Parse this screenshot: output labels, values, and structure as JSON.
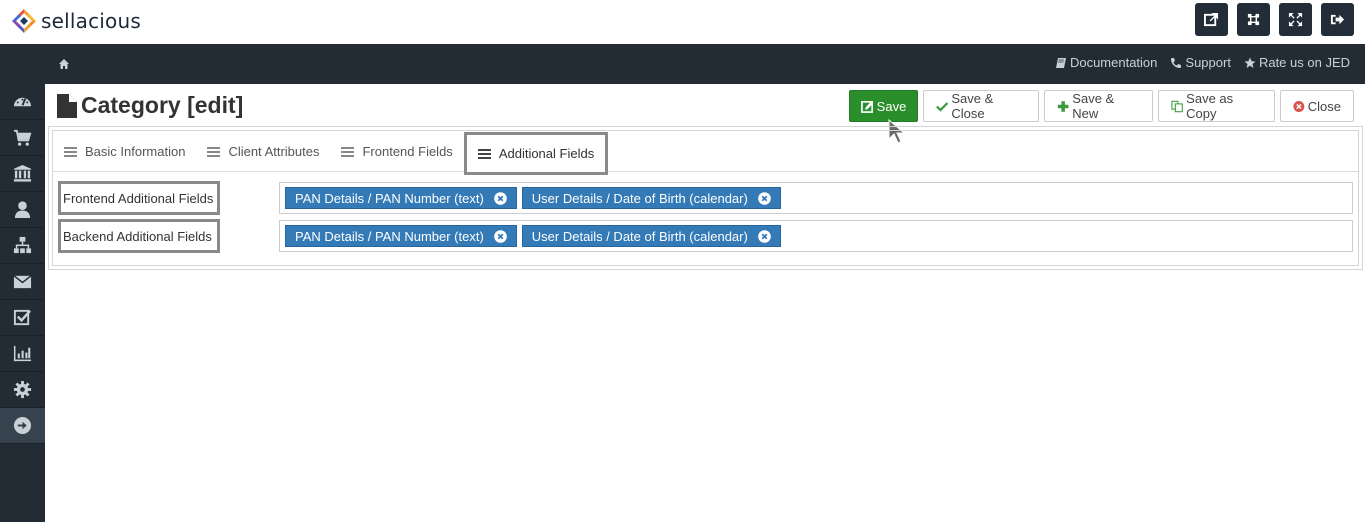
{
  "brand": {
    "name": "sellacious"
  },
  "top_actions": [
    {
      "icon": "external-link-icon",
      "label": "Open site"
    },
    {
      "icon": "joomla-icon",
      "label": "Joomla"
    },
    {
      "icon": "fullscreen-icon",
      "label": "Fullscreen"
    },
    {
      "icon": "logout-icon",
      "label": "Logout"
    }
  ],
  "navbar": {
    "home_icon": "home-icon",
    "links": [
      {
        "icon": "book-icon",
        "label": "Documentation"
      },
      {
        "icon": "phone-icon",
        "label": "Support"
      },
      {
        "icon": "star-icon",
        "label": "Rate us on JED"
      }
    ]
  },
  "sidebar": {
    "items": [
      {
        "icon": "dashboard-icon"
      },
      {
        "icon": "cart-icon"
      },
      {
        "icon": "bank-icon"
      },
      {
        "icon": "user-icon"
      },
      {
        "icon": "sitemap-icon"
      },
      {
        "icon": "envelope-icon"
      },
      {
        "icon": "checkbox-icon"
      },
      {
        "icon": "bar-chart-icon"
      },
      {
        "icon": "gear-icon"
      },
      {
        "icon": "arrow-circle-right-icon",
        "active": true
      }
    ]
  },
  "page": {
    "title": "Category [edit]"
  },
  "toolbar": {
    "save_label": "Save",
    "save_close_label": "Save & Close",
    "save_new_label": "Save & New",
    "save_copy_label": "Save as Copy",
    "close_label": "Close"
  },
  "tabs": [
    {
      "label": "Basic Information",
      "active": false
    },
    {
      "label": "Client Attributes",
      "active": false
    },
    {
      "label": "Frontend Fields",
      "active": false
    },
    {
      "label": "Additional Fields",
      "active": true
    }
  ],
  "fields": {
    "frontend": {
      "label": "Frontend Additional Fields",
      "values": [
        "PAN Details / PAN Number (text)",
        "User Details / Date of Birth (calendar)"
      ]
    },
    "backend": {
      "label": "Backend Additional Fields",
      "values": [
        "PAN Details / PAN Number (text)",
        "User Details / Date of Birth (calendar)"
      ]
    }
  },
  "colors": {
    "primary_save": "#2a8f2a",
    "chip": "#337ab7",
    "dark_bar": "#232c35",
    "close_icon": "#d9534f"
  }
}
